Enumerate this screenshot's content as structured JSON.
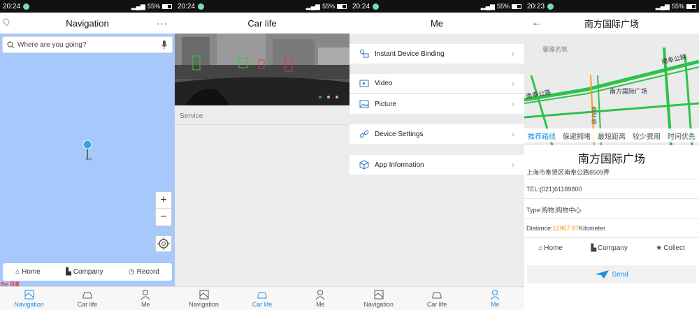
{
  "status_bars": [
    {
      "time": "20:24",
      "battery": "55%"
    },
    {
      "time": "20:24",
      "battery": "55%"
    },
    {
      "time": "20:24",
      "battery": "55%"
    },
    {
      "time": "20:23",
      "battery": "55%"
    }
  ],
  "tabs": [
    {
      "label": "Navigation"
    },
    {
      "label": "Car life"
    },
    {
      "label": "Me"
    }
  ],
  "navigation": {
    "title": "Navigation",
    "more": "···",
    "search_placeholder": "Where are you going?",
    "zoom_in": "+",
    "zoom_out": "−",
    "shortcuts": {
      "home": "Home",
      "company": "Company",
      "record": "Record"
    },
    "brand_logo_text": "Bai 百度"
  },
  "carlife": {
    "title": "Car life",
    "section": "Service"
  },
  "me": {
    "title": "Me",
    "items": [
      {
        "label": "Instant Device Binding",
        "icon": "device-binding-icon"
      },
      {
        "label": "Video",
        "icon": "video-icon"
      },
      {
        "label": "Picture",
        "icon": "picture-icon"
      },
      {
        "label": "Device Settings",
        "icon": "link-icon"
      },
      {
        "label": "App Information",
        "icon": "cube-icon"
      }
    ]
  },
  "poi": {
    "header_title": "南方国际广场",
    "map_labels": {
      "area": "馨雅名筑",
      "road1": "南奉公路",
      "road2": "南奉公路",
      "poi": "南方国际广场",
      "road3": "泰华路"
    },
    "route_options": [
      "推荐路线",
      "躲避拥堵",
      "最短距离",
      "较少费用",
      "时间优先"
    ],
    "name": "南方国际广场",
    "address": "上海市奉贤区南奉公路8509弄",
    "tel": "TEL:(021)61189800",
    "type": "Type:购物;购物中心",
    "distance_label": "Distance:",
    "distance_value": "12967.87",
    "distance_unit": "Kilometer",
    "actions": {
      "home": "Home",
      "company": "Company",
      "collect": "Collect"
    },
    "send": "Send"
  },
  "colors": {
    "accent": "#1e8ee0",
    "map_water": "#a6c8fb",
    "route_green": "#2ec24a",
    "distance_orange": "#f39c12"
  }
}
